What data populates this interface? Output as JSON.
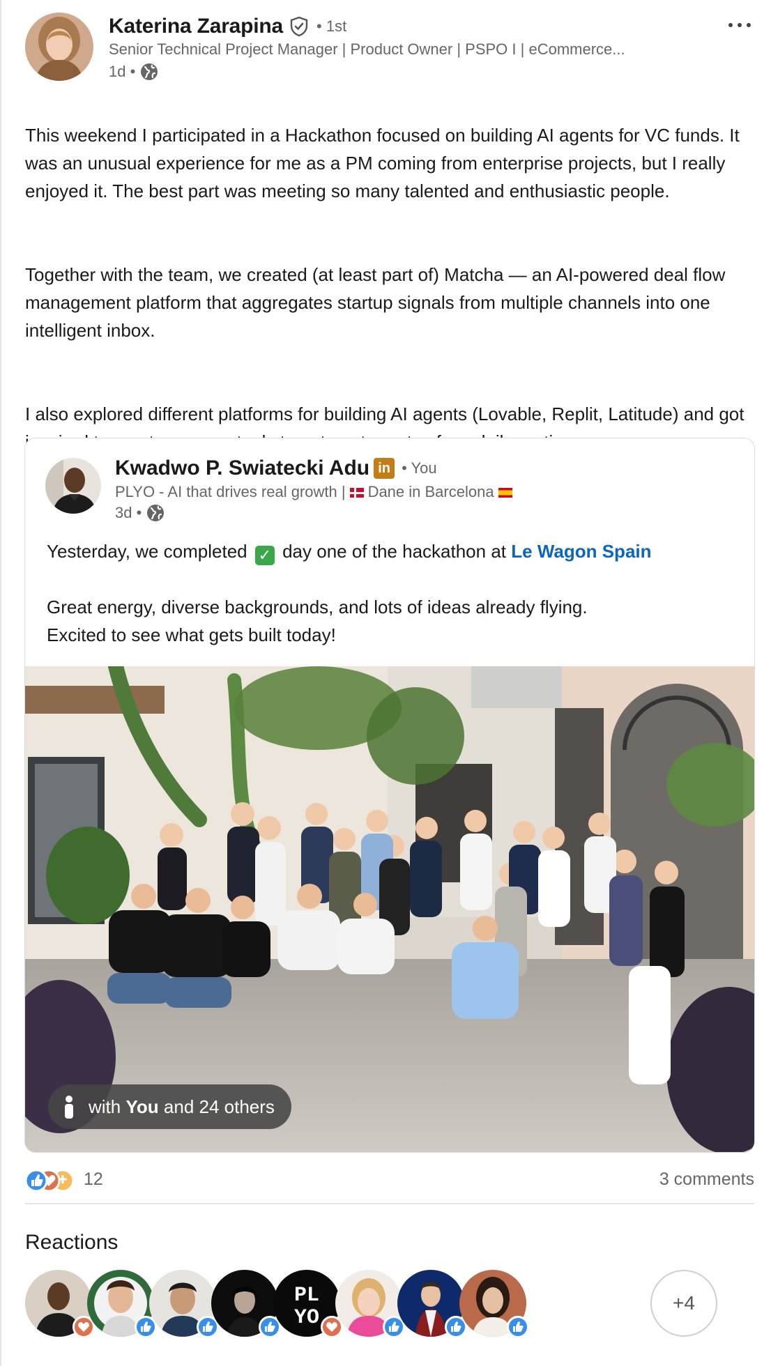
{
  "post": {
    "author": {
      "name": "Katerina Zarapina",
      "degree": "• 1st",
      "headline": "Senior Technical Project Manager | Product Owner | PSPO I | eCommerce...",
      "time": "1d •"
    },
    "paragraph_1": "This weekend I participated in a Hackathon focused on building AI agents for VC funds. It was an unusual experience for me as a PM coming from enterprise projects, but I really enjoyed it. The best part was meeting so many talented and enthusiastic people.",
    "paragraph_2": "Together with the team, we created (at least part of) Matcha — an AI-powered deal flow management platform that aggregates startup signals from multiple channels into one intelligent inbox.",
    "paragraph_3": "I also explored different platforms for building AI agents (Lovable, Replit, Latitude) and got inspired to create my own tools to automate parts of my daily routine."
  },
  "shared": {
    "author": {
      "name": "Kwadwo P. Swiatecki Adu",
      "linkedin_badge": "in",
      "you": "• You",
      "headline_prefix": "PLYO - AI that drives real growth |",
      "headline_suffix": "Dane in Barcelona",
      "time": "3d •"
    },
    "line_1_a": "Yesterday, we completed",
    "check_glyph": "✓",
    "line_1_b": "day one of the  hackathon at",
    "mention": "Le Wagon Spain",
    "line_2": "Great energy, diverse backgrounds, and lots of ideas already flying.",
    "line_3": "Excited to see what gets built today!",
    "tag": {
      "prefix": "with",
      "bold": "You",
      "suffix": "and 24 others"
    }
  },
  "social": {
    "reaction_count": "12",
    "comments": "3 comments"
  },
  "reactions": {
    "title": "Reactions",
    "more": "+4",
    "people": [
      {
        "reaction": "love"
      },
      {
        "reaction": "like"
      },
      {
        "reaction": "like"
      },
      {
        "reaction": "like"
      },
      {
        "reaction": "love",
        "logo": "PLYO"
      },
      {
        "reaction": "like"
      },
      {
        "reaction": "like"
      },
      {
        "reaction": "like"
      }
    ]
  },
  "colors": {
    "link": "#0a66c2",
    "like": "#378fe9",
    "love": "#df704d",
    "linkedin_badge": "#c37d16"
  }
}
